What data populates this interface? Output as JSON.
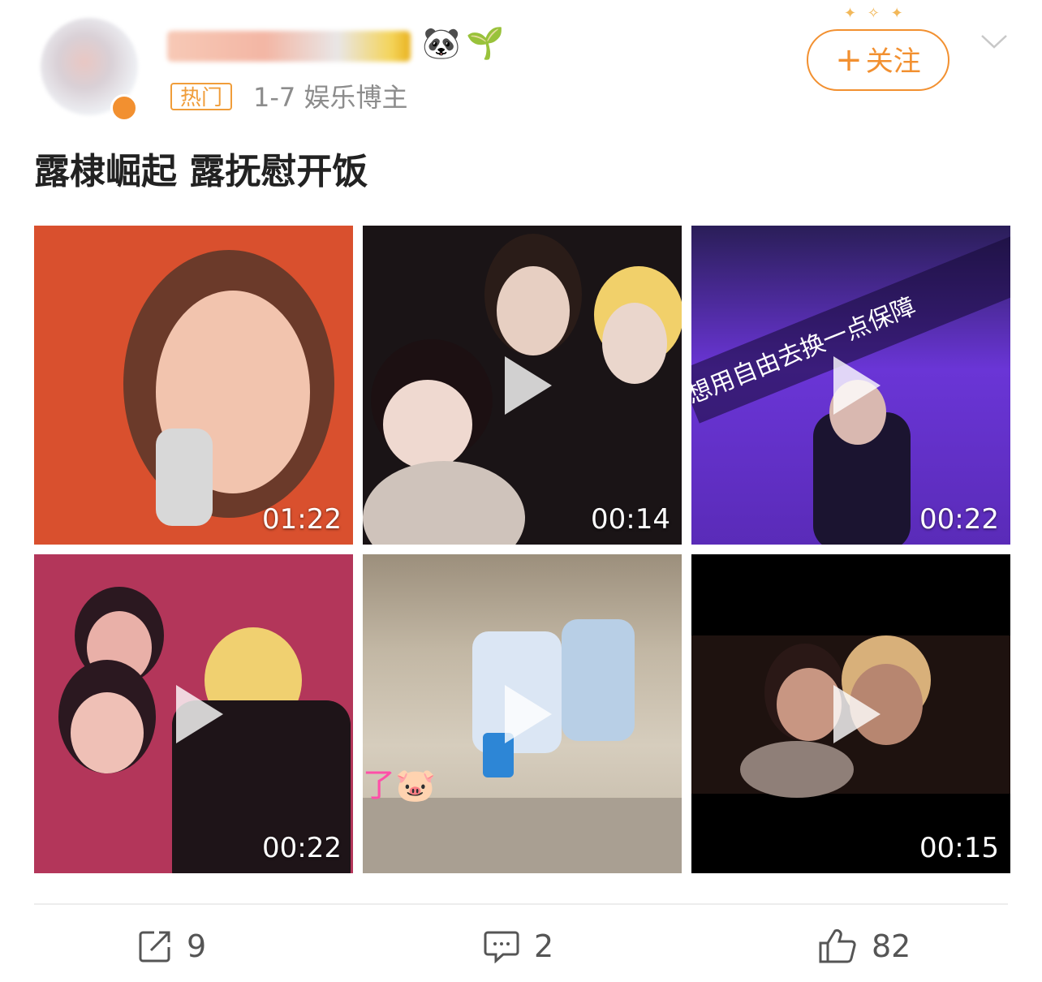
{
  "header": {
    "hot_tag": "热门",
    "meta": "1-7  娱乐博主",
    "follow_label": "关注",
    "follow_plus": "+",
    "emojis": [
      "🐼",
      "🌱"
    ]
  },
  "post": {
    "text": "露棣崛起 露抚慰开饭"
  },
  "videos": [
    {
      "duration": "01:22",
      "colors": [
        "#d9502e",
        "#f2b59c",
        "#4a2a22"
      ]
    },
    {
      "duration": "00:14",
      "colors": [
        "#1a1416",
        "#e7d4c8",
        "#f1d06a"
      ]
    },
    {
      "duration": "00:22",
      "colors": [
        "#5a2bb8",
        "#8f53e6",
        "#1b1430"
      ],
      "overlay_text": "想用自由去换一点保障"
    },
    {
      "duration": "00:22",
      "colors": [
        "#b3365a",
        "#e9a8a0",
        "#2b1820"
      ]
    },
    {
      "duration": "",
      "colors": [
        "#b8aa98",
        "#d2cab8",
        "#a9c6e8"
      ],
      "overlay_text": "了🐷"
    },
    {
      "duration": "00:15",
      "colors": [
        "#000000",
        "#3a2320",
        "#d8b07a"
      ]
    }
  ],
  "actions": {
    "repost_count": "9",
    "comment_count": "2",
    "like_count": "82"
  },
  "colors": {
    "accent": "#f29030",
    "text_gray": "#8c8c8c"
  }
}
